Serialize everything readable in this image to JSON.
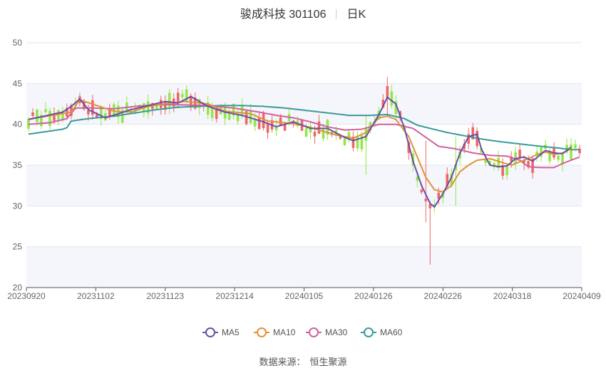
{
  "title": {
    "name": "骏成科技 301106",
    "period": "日K"
  },
  "source": {
    "label": "数据来源：",
    "value": "恒生聚源"
  },
  "colors": {
    "up": "#ee6666",
    "down": "#91e84a",
    "MA5": "#6c4ea6",
    "MA10": "#e0913a",
    "MA30": "#d060a0",
    "MA60": "#3a9a9a"
  },
  "chart_data": {
    "type": "candlestick",
    "x_ticks": [
      "20230920",
      "20231102",
      "20231123",
      "20231214",
      "20240105",
      "20240126",
      "20240226",
      "20240318",
      "20240409"
    ],
    "ylim": [
      20,
      50
    ],
    "y_ticks": [
      20,
      25,
      30,
      35,
      40,
      45,
      50
    ],
    "legend": [
      "MA5",
      "MA10",
      "MA30",
      "MA60"
    ],
    "legend_position": "bottom",
    "ma": {
      "MA5": [
        [
          0,
          40.6
        ],
        [
          8,
          41.5
        ],
        [
          10,
          42.2
        ],
        [
          12,
          43.1
        ],
        [
          14,
          41.8
        ],
        [
          18,
          40.8
        ],
        [
          24,
          41.8
        ],
        [
          28,
          42.3
        ],
        [
          32,
          42.8
        ],
        [
          35,
          42.6
        ],
        [
          38,
          43.4
        ],
        [
          42,
          42.2
        ],
        [
          46,
          41.5
        ],
        [
          50,
          41.1
        ],
        [
          55,
          40.3
        ],
        [
          58,
          39.7
        ],
        [
          62,
          40.3
        ],
        [
          66,
          39.5
        ],
        [
          70,
          39.5
        ],
        [
          74,
          38.4
        ],
        [
          76,
          38.0
        ],
        [
          79,
          38.5
        ],
        [
          82,
          41.2
        ],
        [
          84,
          43.3
        ],
        [
          86,
          42.5
        ],
        [
          88,
          39.5
        ],
        [
          90,
          35.5
        ],
        [
          92,
          32.5
        ],
        [
          94,
          30.3
        ],
        [
          95,
          29.9
        ],
        [
          97,
          31.5
        ],
        [
          99,
          33.5
        ],
        [
          101,
          36.5
        ],
        [
          103,
          38.5
        ],
        [
          105,
          38.8
        ],
        [
          106,
          37.0
        ],
        [
          108,
          35.0
        ],
        [
          110,
          34.8
        ],
        [
          112,
          34.9
        ],
        [
          114,
          35.8
        ],
        [
          116,
          36.0
        ],
        [
          118,
          35.5
        ],
        [
          121,
          36.8
        ],
        [
          123,
          36.5
        ],
        [
          125,
          36.4
        ],
        [
          127,
          37.2
        ]
      ],
      "MA10": [
        [
          0,
          40.6
        ],
        [
          10,
          41.5
        ],
        [
          12,
          43.0
        ],
        [
          16,
          42.3
        ],
        [
          20,
          41.6
        ],
        [
          24,
          41.5
        ],
        [
          28,
          42.2
        ],
        [
          33,
          42.6
        ],
        [
          37,
          42.8
        ],
        [
          42,
          42.5
        ],
        [
          46,
          41.6
        ],
        [
          52,
          41.3
        ],
        [
          56,
          40.4
        ],
        [
          60,
          40.2
        ],
        [
          64,
          39.9
        ],
        [
          68,
          39.3
        ],
        [
          72,
          38.7
        ],
        [
          76,
          38.3
        ],
        [
          79,
          39.0
        ],
        [
          82,
          40.8
        ],
        [
          84,
          41.0
        ],
        [
          86,
          40.6
        ],
        [
          89,
          38.5
        ],
        [
          91,
          36.0
        ],
        [
          93,
          33.5
        ],
        [
          95,
          32.0
        ],
        [
          97,
          31.7
        ],
        [
          99,
          32.5
        ],
        [
          101,
          34.2
        ],
        [
          103,
          35.0
        ],
        [
          105,
          35.6
        ],
        [
          108,
          35.8
        ],
        [
          111,
          35.3
        ],
        [
          113,
          35.0
        ],
        [
          115,
          35.4
        ],
        [
          117,
          35.8
        ],
        [
          119,
          36.3
        ],
        [
          121,
          36.6
        ],
        [
          123,
          36.3
        ],
        [
          125,
          36.5
        ],
        [
          127,
          37.0
        ]
      ],
      "MA30": [
        [
          0,
          40.0
        ],
        [
          5,
          40.2
        ],
        [
          9,
          40.7
        ],
        [
          11,
          42.0
        ],
        [
          15,
          42.0
        ],
        [
          20,
          41.9
        ],
        [
          25,
          42.2
        ],
        [
          30,
          42.4
        ],
        [
          35,
          42.4
        ],
        [
          42,
          42.3
        ],
        [
          48,
          42.0
        ],
        [
          54,
          41.5
        ],
        [
          58,
          41.1
        ],
        [
          62,
          40.8
        ],
        [
          66,
          40.3
        ],
        [
          70,
          39.7
        ],
        [
          74,
          39.3
        ],
        [
          78,
          39.4
        ],
        [
          82,
          40.0
        ],
        [
          86,
          40.0
        ],
        [
          90,
          39.5
        ],
        [
          93,
          38.4
        ],
        [
          96,
          37.3
        ],
        [
          100,
          37.0
        ],
        [
          104,
          36.5
        ],
        [
          108,
          36.2
        ],
        [
          112,
          36.1
        ],
        [
          115,
          35.6
        ],
        [
          117,
          34.8
        ],
        [
          120,
          34.7
        ],
        [
          123,
          34.7
        ],
        [
          125,
          35.2
        ],
        [
          127,
          35.6
        ],
        [
          129,
          36.0
        ]
      ],
      "MA60": [
        [
          0,
          38.8
        ],
        [
          4,
          39.1
        ],
        [
          8,
          39.4
        ],
        [
          9,
          39.6
        ],
        [
          10,
          40.4
        ],
        [
          14,
          40.7
        ],
        [
          20,
          41.0
        ],
        [
          25,
          41.4
        ],
        [
          30,
          41.8
        ],
        [
          35,
          42.1
        ],
        [
          40,
          42.2
        ],
        [
          45,
          42.3
        ],
        [
          50,
          42.3
        ],
        [
          55,
          42.2
        ],
        [
          60,
          42.0
        ],
        [
          65,
          41.7
        ],
        [
          70,
          41.4
        ],
        [
          75,
          41.1
        ],
        [
          80,
          41.1
        ],
        [
          84,
          41.2
        ],
        [
          88,
          40.7
        ],
        [
          91,
          39.9
        ],
        [
          94,
          39.5
        ],
        [
          98,
          39.0
        ],
        [
          102,
          38.6
        ],
        [
          106,
          38.2
        ],
        [
          110,
          37.9
        ],
        [
          115,
          37.6
        ],
        [
          120,
          37.3
        ],
        [
          124,
          37.1
        ],
        [
          127,
          36.9
        ],
        [
          129,
          36.9
        ]
      ]
    }
  }
}
